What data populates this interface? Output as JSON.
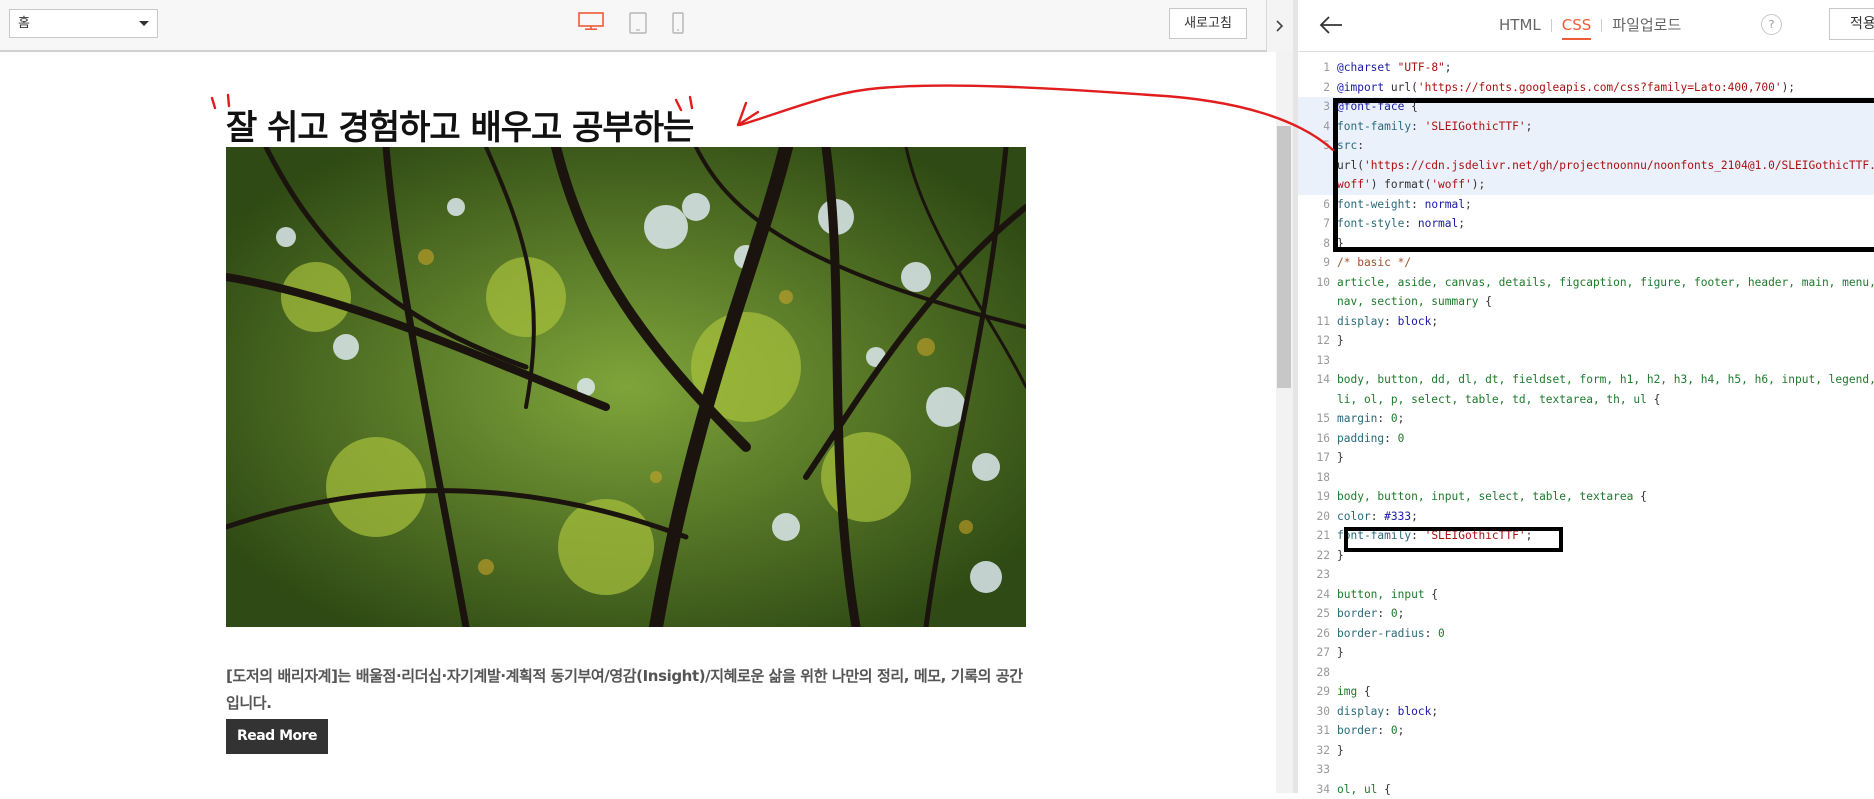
{
  "preview": {
    "page_select": "홈",
    "refresh_label": "새로고침",
    "title": "잘 쉬고 경험하고 배우고 공부하는",
    "description": "[도저의 배리자계]는 배울점·리더십·자기계발·계획적 동기부여/영감(Insight)/지혜로운 삶을 위한 나만의 정리, 메모, 기록의 공간입니다.",
    "read_more": "Read More"
  },
  "editor": {
    "tabs": [
      {
        "label": "HTML",
        "active": false
      },
      {
        "label": "CSS",
        "active": true
      },
      {
        "label": "파일업로드",
        "active": false
      }
    ],
    "help_label": "?",
    "apply_label": "적용",
    "code_lines": [
      {
        "n": "1",
        "html": "<span class=\"k\">@charset</span> <span class=\"s\">\"UTF-8\"</span>;"
      },
      {
        "n": "2",
        "html": "<span class=\"k\">@import</span> url(<span class=\"s\">'https://fonts.googleapis.com/css?family=Lato:400,700'</span>);"
      },
      {
        "n": "3",
        "html": "<span class=\"k\">@font-face</span> {",
        "hl": true
      },
      {
        "n": "4",
        "html": "    <span class=\"p\">font-family</span>: <span class=\"s\">'SLEIGothicTTF'</span>;",
        "hl": true
      },
      {
        "n": "5",
        "html": "    <span class=\"p\">src</span>:",
        "hl": true
      },
      {
        "n": "",
        "html": "url(<span class=\"s\">'https://cdn.jsdelivr.net/gh/projectnoonnu/noonfonts_2104@1.0/SLEIGothicTTF.</span>",
        "hl": true
      },
      {
        "n": "",
        "html": "<span class=\"s\">woff'</span>) format(<span class=\"s\">'woff'</span>);",
        "hl": true
      },
      {
        "n": "6",
        "html": "    <span class=\"p\">font-weight</span>: <span class=\"k\">normal</span>;"
      },
      {
        "n": "7",
        "html": "    <span class=\"p\">font-style</span>: <span class=\"k\">normal</span>;"
      },
      {
        "n": "8",
        "html": "}"
      },
      {
        "n": "9",
        "html": "<span class=\"c\">/* basic */</span>"
      },
      {
        "n": "10",
        "html": "<span class=\"sel\">article, aside, canvas, details, figcaption, figure, footer, header, main, menu,</span>"
      },
      {
        "n": "",
        "html": "<span class=\"sel\">nav, section, summary</span> {"
      },
      {
        "n": "11",
        "html": "  <span class=\"p\">display</span>: <span class=\"k\">block</span>;"
      },
      {
        "n": "12",
        "html": "}"
      },
      {
        "n": "13",
        "html": ""
      },
      {
        "n": "14",
        "html": "<span class=\"sel\">body, button, dd, dl, dt, fieldset, form, h1, h2, h3, h4, h5, h6, input, legend,</span>"
      },
      {
        "n": "",
        "html": "<span class=\"sel\">li, ol, p, select, table, td, textarea, th, ul</span> {"
      },
      {
        "n": "15",
        "html": "  <span class=\"p\">margin</span>: <span class=\"sel\">0</span>;"
      },
      {
        "n": "16",
        "html": "  <span class=\"p\">padding</span>: <span class=\"sel\">0</span>"
      },
      {
        "n": "17",
        "html": "}"
      },
      {
        "n": "18",
        "html": ""
      },
      {
        "n": "19",
        "html": "<span class=\"sel\">body, button, input, select, table, textarea</span> {"
      },
      {
        "n": "20",
        "html": "  <span class=\"p\">color</span>: <span class=\"k\">#333</span>;"
      },
      {
        "n": "21",
        "html": "  <span class=\"p\">font-family</span>: <span class=\"s\">'SLEIGothicTTF'</span>;"
      },
      {
        "n": "22",
        "html": "}"
      },
      {
        "n": "23",
        "html": ""
      },
      {
        "n": "24",
        "html": "<span class=\"sel\">button, input</span> {"
      },
      {
        "n": "25",
        "html": "  <span class=\"p\">border</span>: <span class=\"sel\">0</span>;"
      },
      {
        "n": "26",
        "html": "  <span class=\"p\">border-radius</span>: <span class=\"sel\">0</span>"
      },
      {
        "n": "27",
        "html": "}"
      },
      {
        "n": "28",
        "html": ""
      },
      {
        "n": "29",
        "html": "<span class=\"sel\">img</span> {"
      },
      {
        "n": "30",
        "html": "  <span class=\"p\">display</span>: <span class=\"k\">block</span>;"
      },
      {
        "n": "31",
        "html": "  <span class=\"p\">border</span>: <span class=\"sel\">0</span>;"
      },
      {
        "n": "32",
        "html": "}"
      },
      {
        "n": "33",
        "html": ""
      },
      {
        "n": "34",
        "html": "<span class=\"sel\">ol, ul</span> {"
      }
    ]
  },
  "colors": {
    "accent": "#ef5a39",
    "annotation": "#e11d1d"
  }
}
